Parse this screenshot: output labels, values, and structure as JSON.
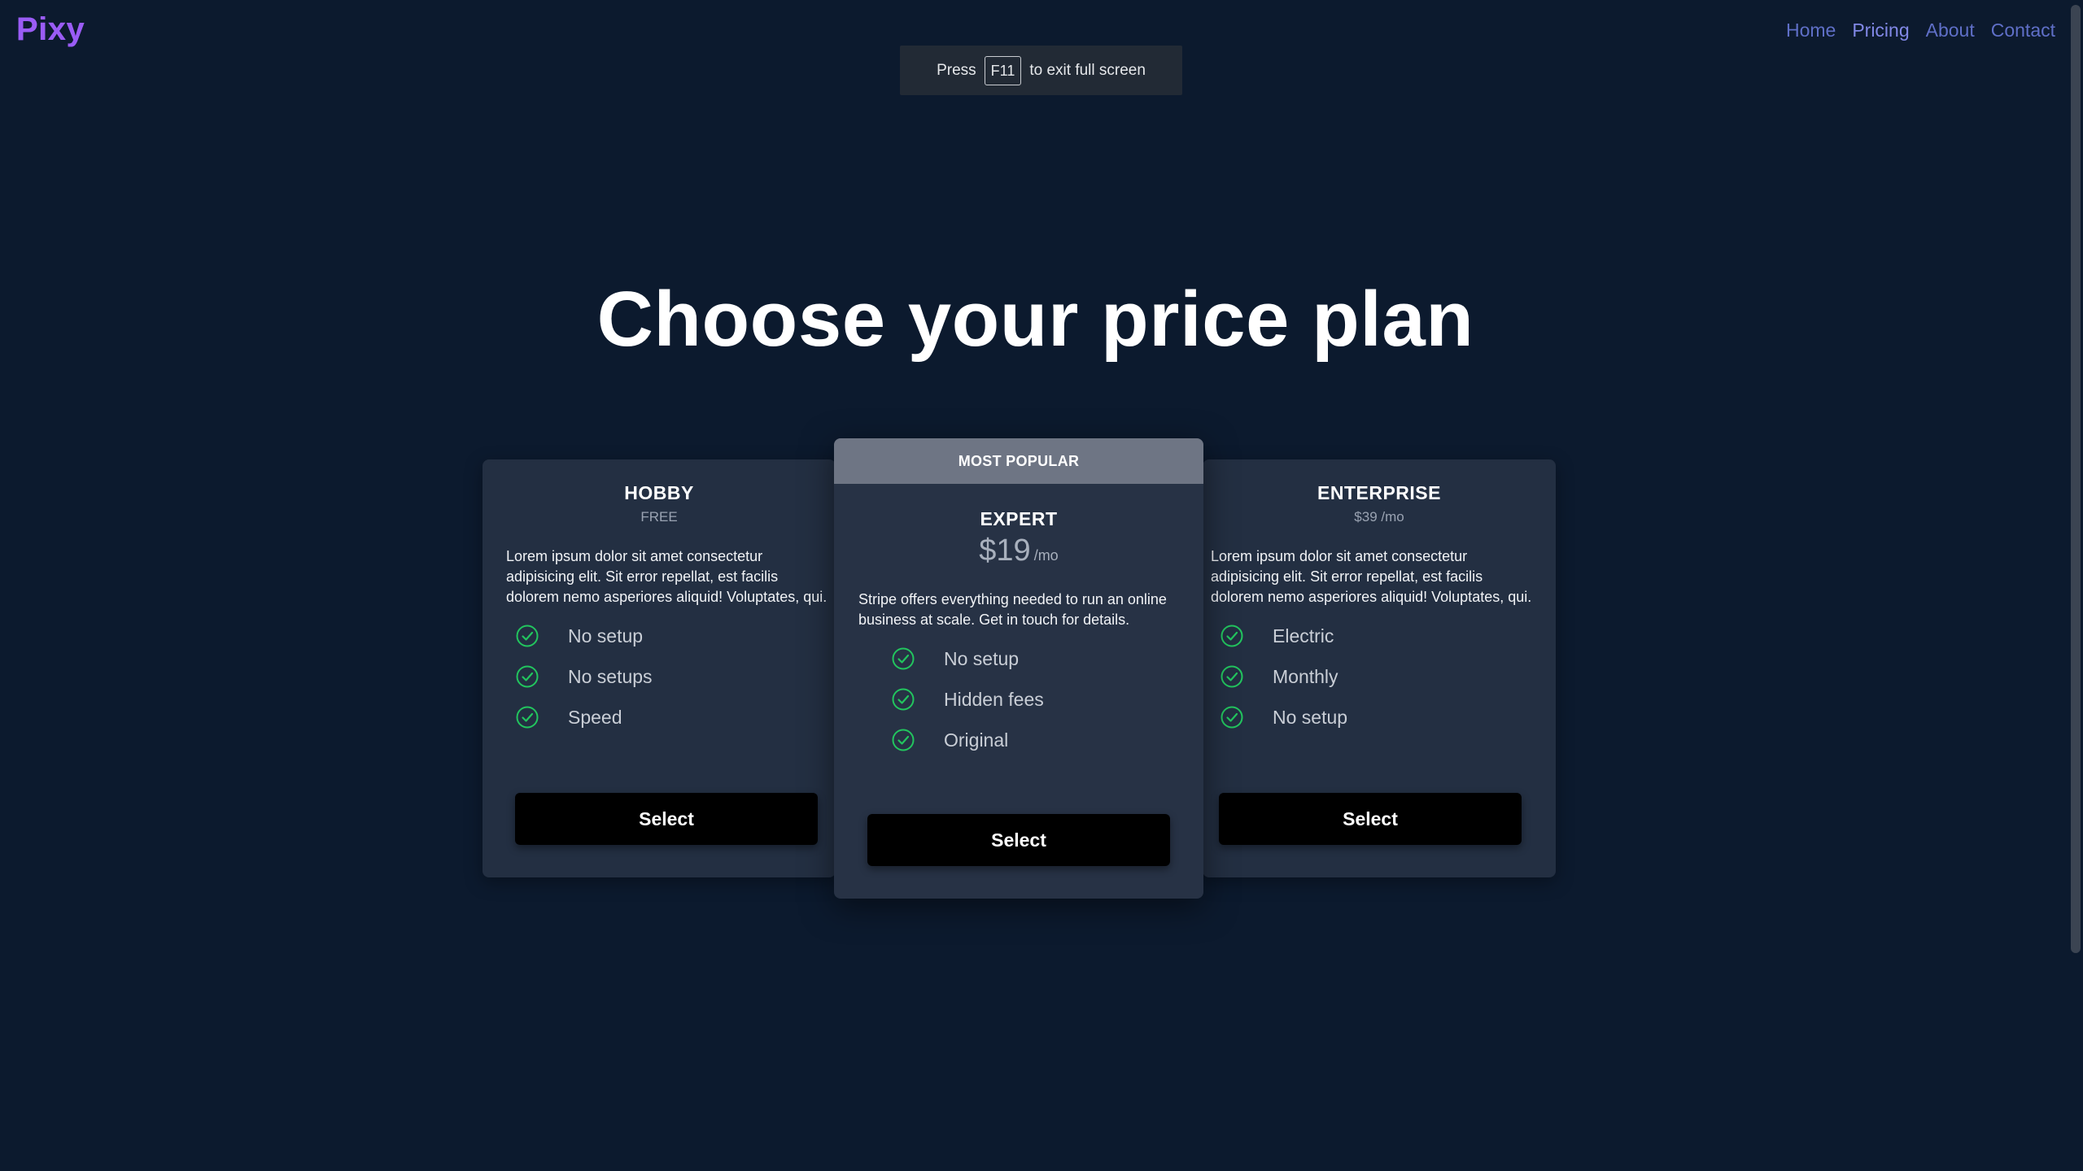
{
  "brand": {
    "logo": "Pixy"
  },
  "nav": {
    "items": [
      {
        "label": "Home"
      },
      {
        "label": "Pricing"
      },
      {
        "label": "About"
      },
      {
        "label": "Contact"
      }
    ]
  },
  "fullscreen_notice": {
    "prefix": "Press",
    "key": "F11",
    "suffix": "to exit full screen"
  },
  "heading": "Choose your price plan",
  "plans": {
    "hobby": {
      "name": "HOBBY",
      "price": "FREE",
      "description": "Lorem ipsum dolor sit amet consectetur adipisicing elit. Sit error repellat, est facilis dolorem nemo asperiores aliquid! Voluptates, qui.",
      "features": [
        "No setup",
        "No setups",
        "Speed"
      ],
      "button": "Select"
    },
    "expert": {
      "ribbon": "MOST POPULAR",
      "name": "EXPERT",
      "price_amount": "$19",
      "price_period": "/mo",
      "description": "Stripe offers everything needed to run an online business at scale. Get in touch for details.",
      "features": [
        "No setup",
        "Hidden fees",
        "Original"
      ],
      "button": "Select"
    },
    "enterprise": {
      "name": "ENTERPRISE",
      "price": "$39 /mo",
      "description": "Lorem ipsum dolor sit amet consectetur adipisicing elit. Sit error repellat, est facilis dolorem nemo asperiores aliquid! Voluptates, qui.",
      "features": [
        "Electric",
        "Monthly",
        "No setup"
      ],
      "button": "Select"
    }
  },
  "colors": {
    "background": "#0c1a2e",
    "card": "#232f42",
    "accent": "#8188e6",
    "check": "#22c55e"
  },
  "icons": {
    "feature": "check-circle-icon"
  }
}
